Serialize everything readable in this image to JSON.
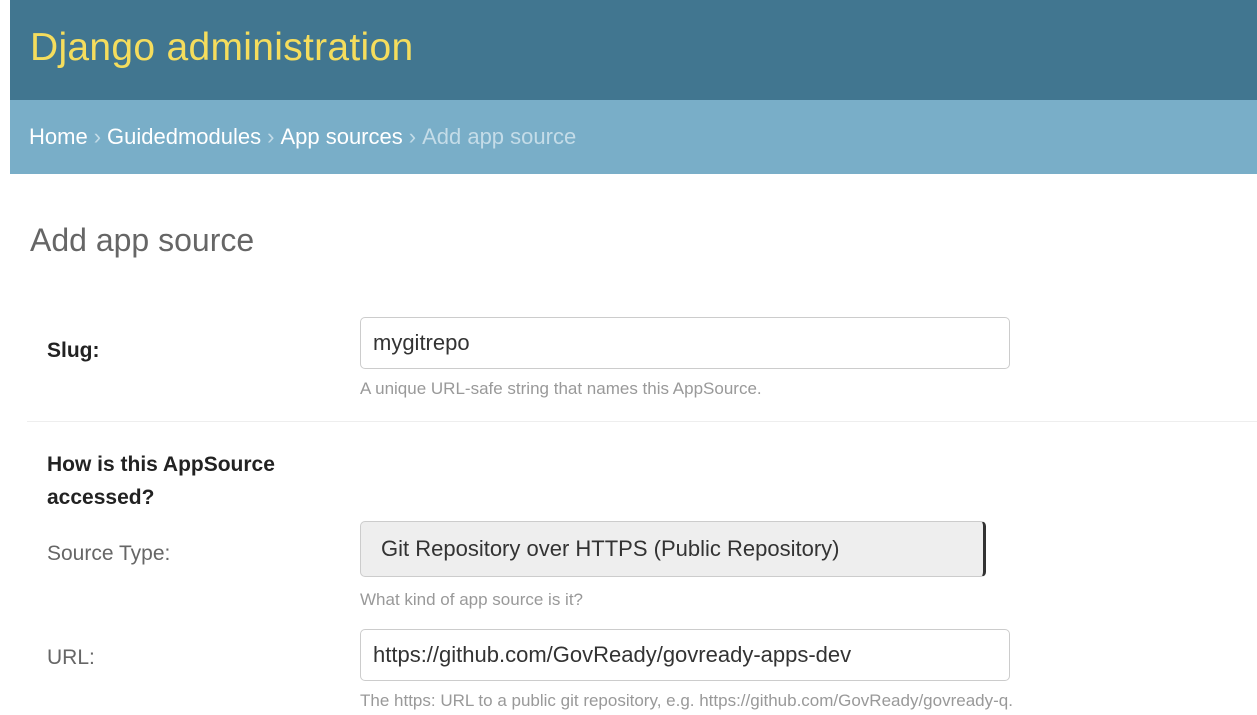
{
  "header": {
    "title": "Django administration"
  },
  "breadcrumbs": {
    "items": [
      "Home",
      "Guidedmodules",
      "App sources"
    ],
    "separator": "›",
    "current": "Add app source"
  },
  "page": {
    "title": "Add app source"
  },
  "form": {
    "slug": {
      "label": "Slug:",
      "value": "mygitrepo",
      "help": "A unique URL-safe string that names this AppSource."
    },
    "access_section": {
      "title": "How is this AppSource accessed?"
    },
    "source_type": {
      "label": "Source Type:",
      "value": "Git Repository over HTTPS (Public Repository)",
      "help": "What kind of app source is it?"
    },
    "url": {
      "label": "URL:",
      "value": "https://github.com/GovReady/govready-apps-dev",
      "help": "The https: URL to a public git repository, e.g. https://github.com/GovReady/govready-q."
    }
  },
  "colors": {
    "header_bg": "#417690",
    "breadcrumb_bg": "#79aec8",
    "brand_text": "#f5dd5d"
  }
}
